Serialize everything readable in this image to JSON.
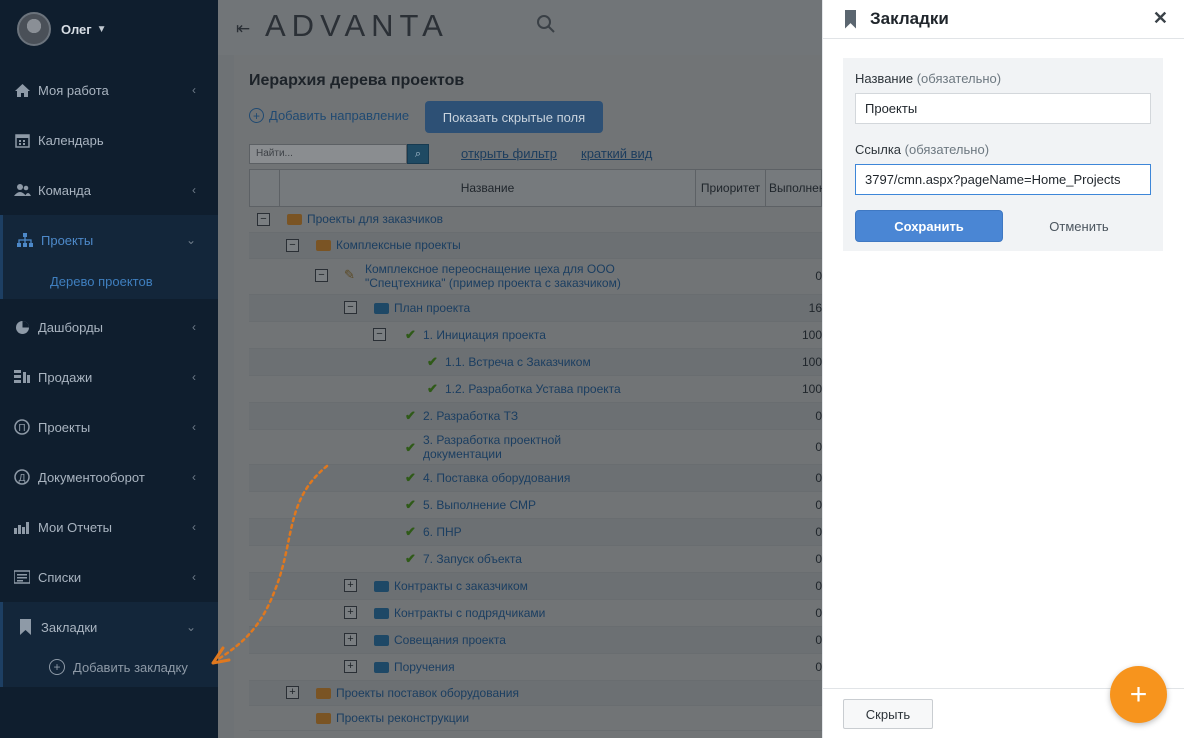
{
  "user": {
    "name": "Олег"
  },
  "sidebar": {
    "items": [
      {
        "label": "Моя работа",
        "icon": "home-icon"
      },
      {
        "label": "Календарь",
        "icon": "calendar-icon"
      },
      {
        "label": "Команда",
        "icon": "team-icon"
      },
      {
        "label": "Проекты",
        "icon": "hierarchy-icon",
        "active": true
      },
      {
        "label": "Дашборды",
        "icon": "pie-chart-icon"
      },
      {
        "label": "Продажи",
        "icon": "sales-icon"
      },
      {
        "label": "Проекты",
        "icon": "projects-circle-icon"
      },
      {
        "label": "Документооборот",
        "icon": "document-flow-icon"
      },
      {
        "label": "Мои Отчеты",
        "icon": "bar-chart-icon"
      },
      {
        "label": "Списки",
        "icon": "list-icon"
      },
      {
        "label": "Закладки",
        "icon": "bookmark-icon",
        "active": true
      }
    ],
    "sub_project_tree": "Дерево проектов",
    "sub_add_bookmark": "Добавить закладку"
  },
  "header": {
    "logo": "ADVANTA"
  },
  "main": {
    "title": "Иерархия дерева проектов",
    "add_direction": "Добавить направление",
    "show_hidden": "Показать скрытые поля",
    "search_placeholder": "Найти...",
    "open_filter": "открыть фильтр",
    "short_view": "краткий вид",
    "columns": [
      "Название",
      "Приоритет",
      "Выполнен"
    ],
    "rows": [
      {
        "name": "Проекты для заказчиков",
        "value": ""
      },
      {
        "name": "Комплексные проекты",
        "value": ""
      },
      {
        "name": "Комплексное переоснащение цеха для ООО \"Спецтехника\" (пример проекта с заказчиком)",
        "value": "0"
      },
      {
        "name": "План проекта",
        "value": "16"
      },
      {
        "name": "1. Инициация проекта",
        "value": "100"
      },
      {
        "name": "1.1. Встреча с Заказчиком",
        "value": "100"
      },
      {
        "name": "1.2. Разработка Устава проекта",
        "value": "100"
      },
      {
        "name": "2. Разработка ТЗ",
        "value": "0"
      },
      {
        "name": "3. Разработка проектной документации",
        "value": "0"
      },
      {
        "name": "4. Поставка оборудования",
        "value": "0"
      },
      {
        "name": "5. Выполнение СМР",
        "value": "0"
      },
      {
        "name": "6. ПНР",
        "value": "0"
      },
      {
        "name": "7. Запуск объекта",
        "value": "0"
      },
      {
        "name": "Контракты с заказчиком",
        "value": "0"
      },
      {
        "name": "Контракты с подрядчиками",
        "value": "0"
      },
      {
        "name": "Совещания проекта",
        "value": "0"
      },
      {
        "name": "Поручения",
        "value": "0"
      },
      {
        "name": "Проекты поставок оборудования",
        "value": ""
      },
      {
        "name": "Проекты реконструкции",
        "value": ""
      }
    ]
  },
  "panel": {
    "title": "Закладки",
    "name_label": "Название",
    "name_req": "(обязательно)",
    "name_value": "Проекты",
    "link_label": "Ссылка",
    "link_req": "(обязательно)",
    "link_value": "3797/cmn.aspx?pageName=Home_Projects",
    "save": "Сохранить",
    "cancel": "Отменить",
    "hide": "Скрыть"
  },
  "colors": {
    "accent": "#4a86d4",
    "fab": "#f7941d",
    "sidebar_bg": "#0f1e2e"
  }
}
